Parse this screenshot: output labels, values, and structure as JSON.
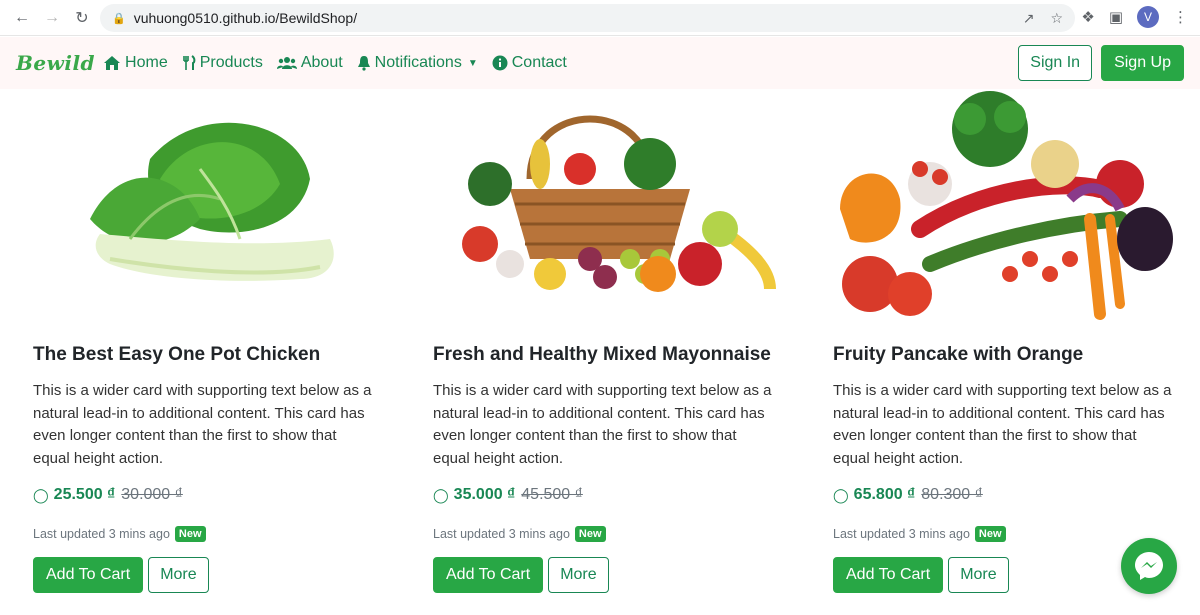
{
  "browser": {
    "url": "vuhuong0510.github.io/BewildShop/",
    "avatar_letter": "V"
  },
  "navbar": {
    "brand": "Bewild",
    "items": [
      {
        "label": "Home",
        "icon": "home-icon"
      },
      {
        "label": "Products",
        "icon": "utensils-icon"
      },
      {
        "label": "About",
        "icon": "users-icon"
      },
      {
        "label": "Notifications",
        "icon": "bell-icon"
      },
      {
        "label": "Contact",
        "icon": "info-icon"
      }
    ],
    "sign_in": "Sign In",
    "sign_up": "Sign Up"
  },
  "cards": [
    {
      "title": "The Best Easy One Pot Chicken",
      "text": "This is a wider card with supporting text below as a natural lead-in to additional content. This card has even longer content than the first to show that equal height action.",
      "price": "25.500 ₫",
      "old_price": "30.000 ₫",
      "updated": "Last updated 3 mins ago",
      "badge": "New",
      "add_label": "Add To Cart",
      "more_label": "More",
      "image": "bok-choy-image"
    },
    {
      "title": "Fresh and Healthy Mixed Mayonnaise",
      "text": "This is a wider card with supporting text below as a natural lead-in to additional content. This card has even longer content than the first to show that equal height action.",
      "price": "35.000 ₫",
      "old_price": "45.500 ₫",
      "updated": "Last updated 3 mins ago",
      "badge": "New",
      "add_label": "Add To Cart",
      "more_label": "More",
      "image": "fruit-basket-image"
    },
    {
      "title": "Fruity Pancake with Orange",
      "text": "This is a wider card with supporting text below as a natural lead-in to additional content. This card has even longer content than the first to show that equal height action.",
      "price": "65.800 ₫",
      "old_price": "80.300 ₫",
      "updated": "Last updated 3 mins ago",
      "badge": "New",
      "add_label": "Add To Cart",
      "more_label": "More",
      "image": "vegetables-image"
    }
  ],
  "colors": {
    "brand": "#3aa84a",
    "primary": "#28a745",
    "nav_text": "#198754",
    "navbar_bg": "#fff7f7"
  }
}
